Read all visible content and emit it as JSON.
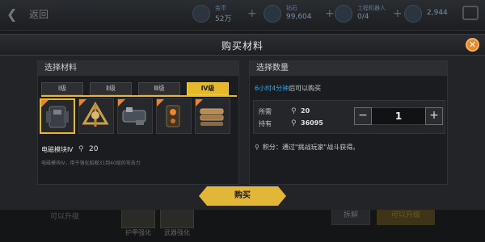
{
  "topbar": {
    "back_label": "返回",
    "resources": [
      {
        "name": "金币",
        "value": "52万"
      },
      {
        "name": "钻石",
        "value": "99,604"
      },
      {
        "name": "工程机器人",
        "value": "0/4"
      },
      {
        "name": "",
        "value": "2,944"
      }
    ]
  },
  "dialog": {
    "title": "购买材料",
    "left_panel": {
      "heading": "选择材料",
      "tabs": [
        {
          "label": "Ⅰ级",
          "active": false
        },
        {
          "label": "Ⅱ级",
          "active": false
        },
        {
          "label": "Ⅲ级",
          "active": false
        },
        {
          "label": "Ⅳ级",
          "active": true
        }
      ],
      "items": [
        {
          "icon": "armor-module-icon",
          "selected": true
        },
        {
          "icon": "tripod-part-icon",
          "selected": false
        },
        {
          "icon": "engine-part-icon",
          "selected": false
        },
        {
          "icon": "reactor-part-icon",
          "selected": false
        },
        {
          "icon": "ammo-belt-icon",
          "selected": false
        }
      ],
      "selected_name": "电磁模块Ⅳ",
      "selected_count": "20",
      "selected_desc": "电磁模块Ⅳ，用于强化船舰31到40级的攻击力"
    },
    "right_panel": {
      "heading": "选择数量",
      "cooldown_time": "6小时4分钟",
      "cooldown_suffix": "后可以购买",
      "required_label": "所需",
      "required_value": "20",
      "owned_label": "持有",
      "owned_value": "36095",
      "quantity": "1",
      "source_text": "积分：通过\"挑战玩家\"战斗获得。"
    },
    "buy_label": "购买"
  },
  "background": {
    "can_upgrade": "可以升级",
    "tile_labels": [
      "护甲强化",
      "武器强化"
    ],
    "disassemble_label": "拆解",
    "upgrade_label": "可以升级"
  },
  "colors": {
    "accent": "#e5b92a",
    "close": "#e38a2c",
    "cooldown": "#35a7e5"
  }
}
